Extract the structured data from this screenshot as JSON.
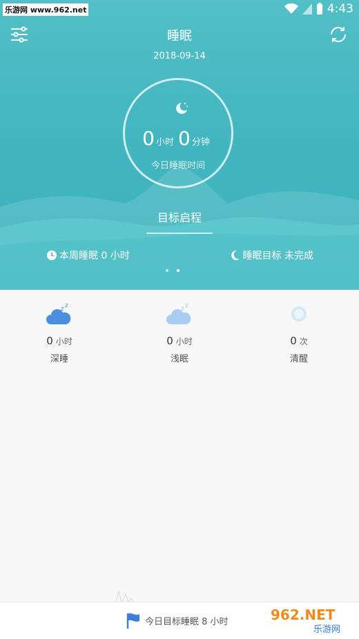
{
  "statusbar": {
    "site": "乐游网 www.962.net",
    "time": "4:43"
  },
  "header": {
    "title": "睡眠",
    "date": "2018-09-14"
  },
  "summary": {
    "hours": "0",
    "hours_unit": "小时",
    "minutes": "0",
    "minutes_unit": "分钟",
    "caption": "今日睡眠时间"
  },
  "goal_button": "目标启程",
  "stats": {
    "weekly": "本周睡眠 0 小时",
    "goal_status": "睡眠目标 未完成"
  },
  "pager": {
    "count": 2,
    "active": 1
  },
  "metrics": [
    {
      "value": "0",
      "unit": "小时",
      "label": "深睡",
      "icon": "deep-sleep-cloud-icon"
    },
    {
      "value": "0",
      "unit": "小时",
      "label": "浅眠",
      "icon": "light-sleep-cloud-icon"
    },
    {
      "value": "0",
      "unit": "次",
      "label": "清醒",
      "icon": "awake-circle-icon"
    }
  ],
  "footer": {
    "goal_text": "今日目标睡眠 8 小时"
  },
  "watermark": {
    "line1": "962.NET",
    "line2": "乐游网"
  },
  "colors": {
    "teal": "#44b7c1",
    "deep_blue": "#4a8fe0",
    "light_blue": "#a9cdf0"
  }
}
